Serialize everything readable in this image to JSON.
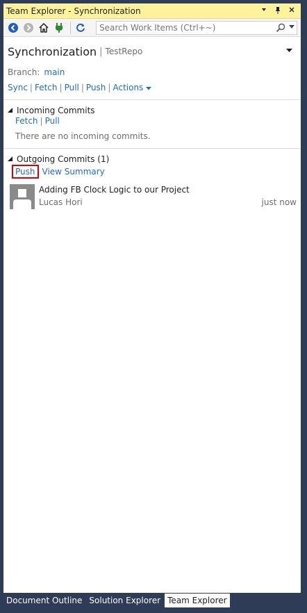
{
  "window": {
    "title": "Team Explorer - Synchronization",
    "controls": [
      "dropdown-icon",
      "pin-icon",
      "close-icon"
    ]
  },
  "toolbar": {
    "icons": [
      "back-icon",
      "forward-icon",
      "home-icon",
      "connect-icon",
      "refresh-icon"
    ],
    "search_placeholder": "Search Work Items (Ctrl+~)"
  },
  "header": {
    "page_title": "Synchronization",
    "separator": "|",
    "repo": "TestRepo"
  },
  "branch": {
    "label": "Branch:",
    "value": "main"
  },
  "actions": {
    "sync": "Sync",
    "fetch": "Fetch",
    "pull": "Pull",
    "push": "Push",
    "actions": "Actions",
    "separator": "|"
  },
  "incoming": {
    "title": "Incoming Commits",
    "fetch": "Fetch",
    "pull": "Pull",
    "empty": "There are no incoming commits."
  },
  "outgoing": {
    "title": "Outgoing Commits (1)",
    "push": "Push",
    "view_summary": "View Summary",
    "commits": [
      {
        "message": "Adding FB Clock Logic to our Project",
        "author": "Lucas Hori",
        "time": "just now"
      }
    ]
  },
  "bottom_tabs": [
    "Document Outline",
    "Solution Explorer",
    "Team Explorer"
  ],
  "colors": {
    "title_bar": "#fff29d",
    "link": "#1e6ad6",
    "highlight": "#e00000",
    "frame": "#2e3c58"
  }
}
